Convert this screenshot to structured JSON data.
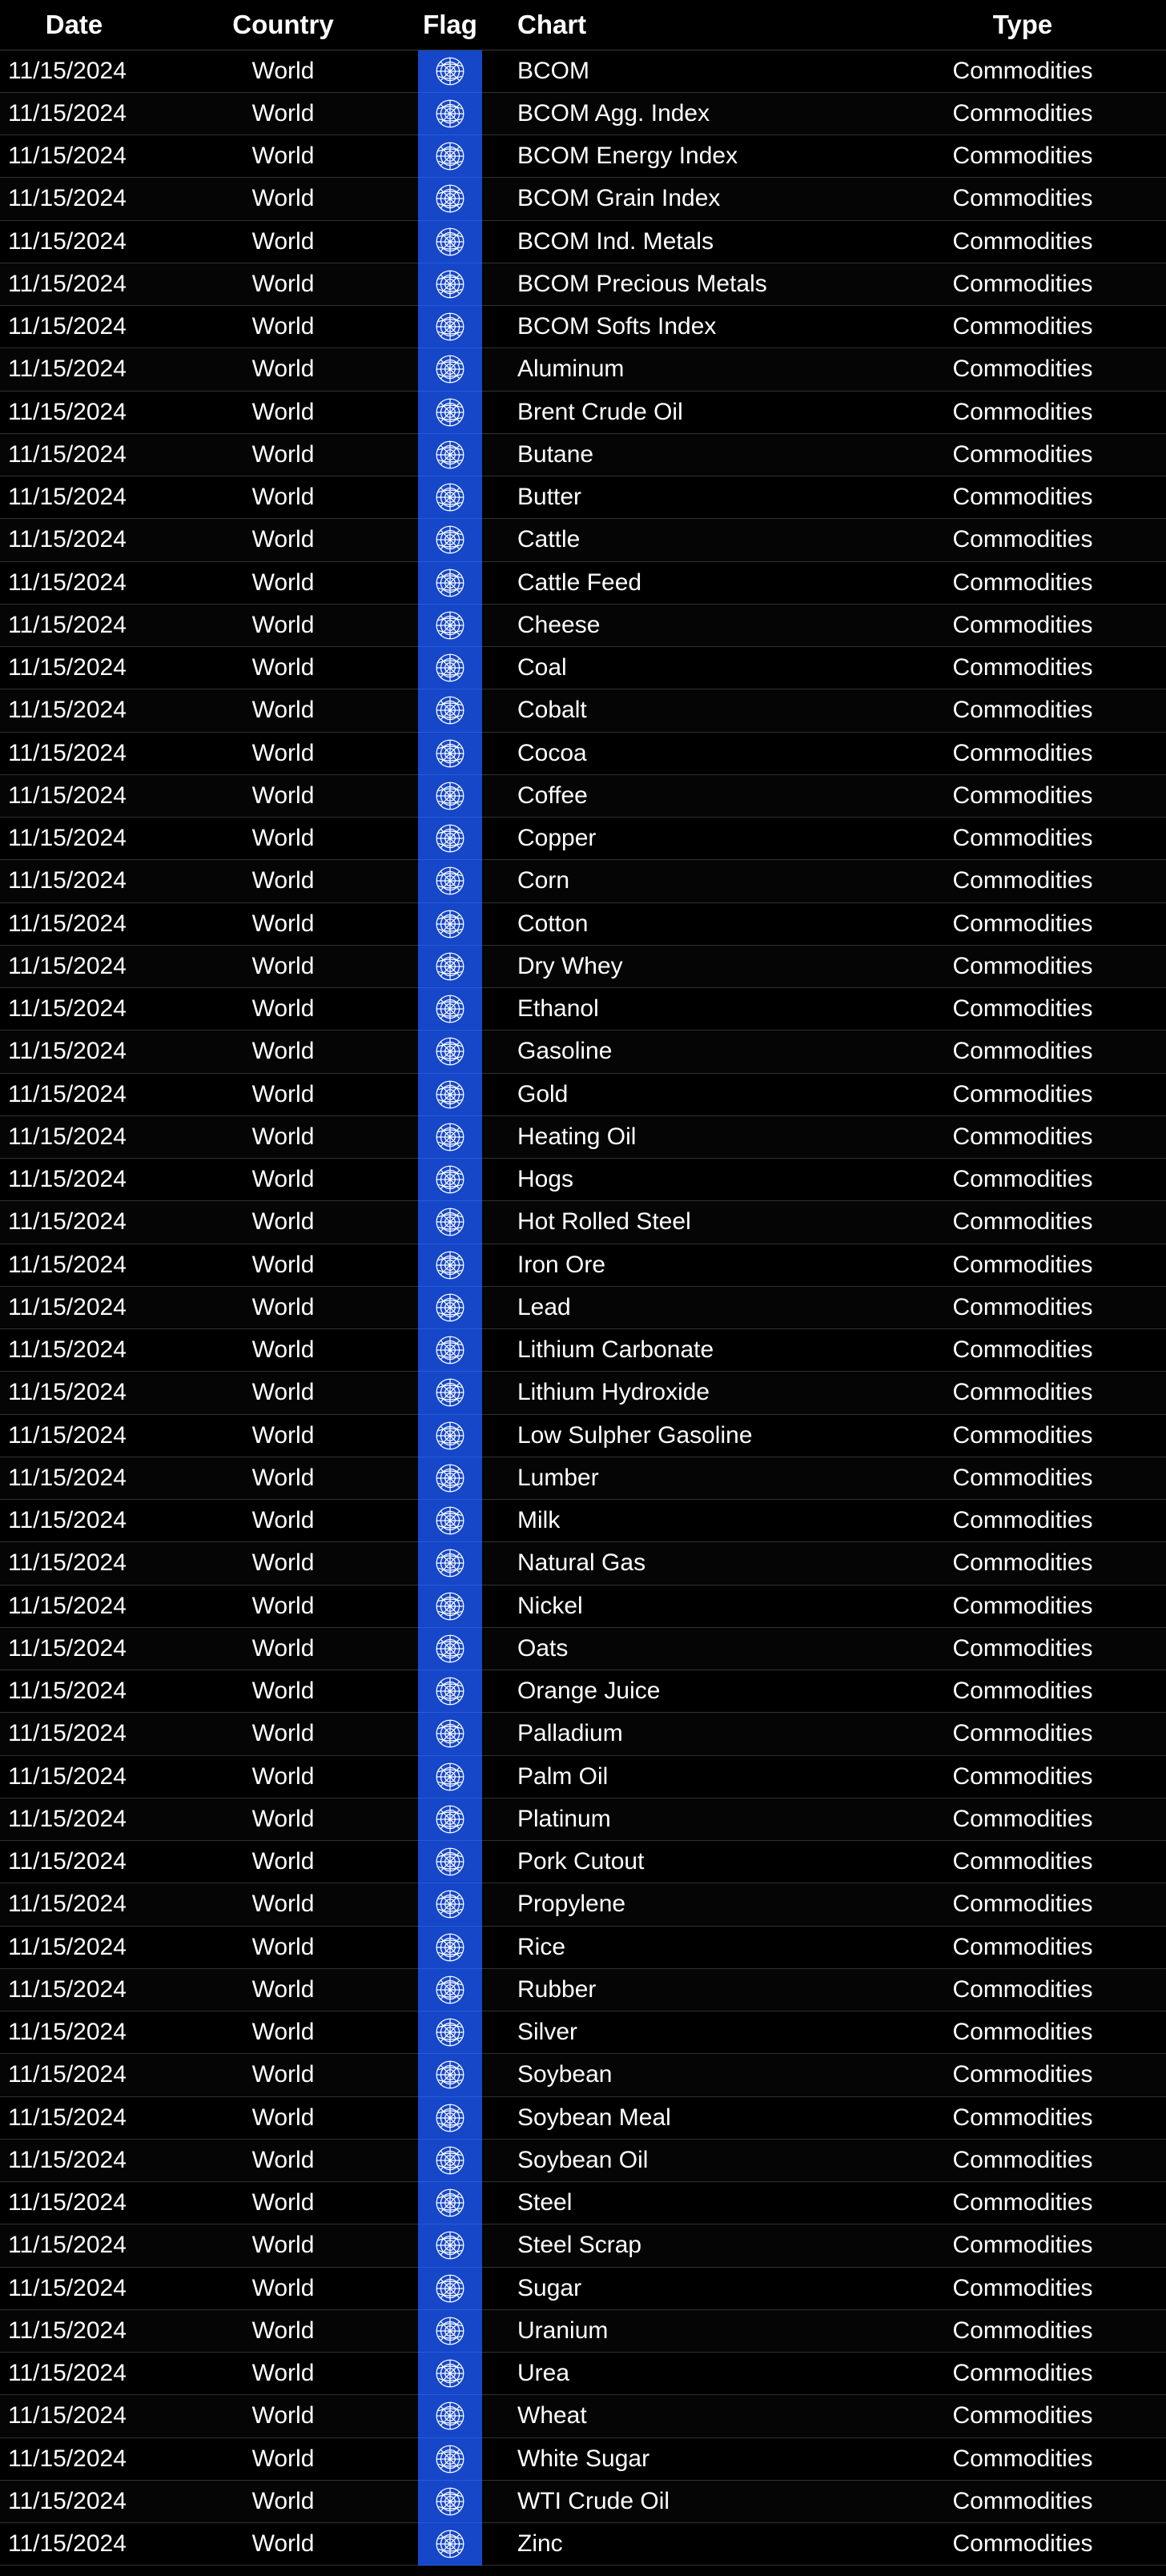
{
  "headers": {
    "date": "Date",
    "country": "Country",
    "flag": "Flag",
    "chart": "Chart",
    "type": "Type"
  },
  "colors": {
    "background": "#000000",
    "flag_cell": "#1547c8",
    "text": "#ffffff",
    "grid": "#303030"
  },
  "flag_icon": "un-world-emblem-icon",
  "rows": [
    {
      "date": "11/15/2024",
      "country": "World",
      "chart": "BCOM",
      "type": "Commodities"
    },
    {
      "date": "11/15/2024",
      "country": "World",
      "chart": "BCOM Agg. Index",
      "type": "Commodities"
    },
    {
      "date": "11/15/2024",
      "country": "World",
      "chart": "BCOM Energy Index",
      "type": "Commodities"
    },
    {
      "date": "11/15/2024",
      "country": "World",
      "chart": "BCOM Grain Index",
      "type": "Commodities"
    },
    {
      "date": "11/15/2024",
      "country": "World",
      "chart": "BCOM Ind. Metals",
      "type": "Commodities"
    },
    {
      "date": "11/15/2024",
      "country": "World",
      "chart": "BCOM Precious Metals",
      "type": "Commodities"
    },
    {
      "date": "11/15/2024",
      "country": "World",
      "chart": "BCOM Softs Index",
      "type": "Commodities"
    },
    {
      "date": "11/15/2024",
      "country": "World",
      "chart": "Aluminum",
      "type": "Commodities"
    },
    {
      "date": "11/15/2024",
      "country": "World",
      "chart": "Brent Crude Oil",
      "type": "Commodities"
    },
    {
      "date": "11/15/2024",
      "country": "World",
      "chart": "Butane",
      "type": "Commodities"
    },
    {
      "date": "11/15/2024",
      "country": "World",
      "chart": "Butter",
      "type": "Commodities"
    },
    {
      "date": "11/15/2024",
      "country": "World",
      "chart": "Cattle",
      "type": "Commodities"
    },
    {
      "date": "11/15/2024",
      "country": "World",
      "chart": "Cattle Feed",
      "type": "Commodities"
    },
    {
      "date": "11/15/2024",
      "country": "World",
      "chart": "Cheese",
      "type": "Commodities"
    },
    {
      "date": "11/15/2024",
      "country": "World",
      "chart": "Coal",
      "type": "Commodities"
    },
    {
      "date": "11/15/2024",
      "country": "World",
      "chart": "Cobalt",
      "type": "Commodities"
    },
    {
      "date": "11/15/2024",
      "country": "World",
      "chart": "Cocoa",
      "type": "Commodities"
    },
    {
      "date": "11/15/2024",
      "country": "World",
      "chart": "Coffee",
      "type": "Commodities"
    },
    {
      "date": "11/15/2024",
      "country": "World",
      "chart": "Copper",
      "type": "Commodities"
    },
    {
      "date": "11/15/2024",
      "country": "World",
      "chart": "Corn",
      "type": "Commodities"
    },
    {
      "date": "11/15/2024",
      "country": "World",
      "chart": "Cotton",
      "type": "Commodities"
    },
    {
      "date": "11/15/2024",
      "country": "World",
      "chart": "Dry Whey",
      "type": "Commodities"
    },
    {
      "date": "11/15/2024",
      "country": "World",
      "chart": "Ethanol",
      "type": "Commodities"
    },
    {
      "date": "11/15/2024",
      "country": "World",
      "chart": "Gasoline",
      "type": "Commodities"
    },
    {
      "date": "11/15/2024",
      "country": "World",
      "chart": "Gold",
      "type": "Commodities"
    },
    {
      "date": "11/15/2024",
      "country": "World",
      "chart": "Heating Oil",
      "type": "Commodities"
    },
    {
      "date": "11/15/2024",
      "country": "World",
      "chart": "Hogs",
      "type": "Commodities"
    },
    {
      "date": "11/15/2024",
      "country": "World",
      "chart": "Hot Rolled Steel",
      "type": "Commodities"
    },
    {
      "date": "11/15/2024",
      "country": "World",
      "chart": "Iron Ore",
      "type": "Commodities"
    },
    {
      "date": "11/15/2024",
      "country": "World",
      "chart": "Lead",
      "type": "Commodities"
    },
    {
      "date": "11/15/2024",
      "country": "World",
      "chart": "Lithium Carbonate",
      "type": "Commodities"
    },
    {
      "date": "11/15/2024",
      "country": "World",
      "chart": "Lithium Hydroxide",
      "type": "Commodities"
    },
    {
      "date": "11/15/2024",
      "country": "World",
      "chart": "Low Sulpher Gasoline",
      "type": "Commodities"
    },
    {
      "date": "11/15/2024",
      "country": "World",
      "chart": "Lumber",
      "type": "Commodities"
    },
    {
      "date": "11/15/2024",
      "country": "World",
      "chart": "Milk",
      "type": "Commodities"
    },
    {
      "date": "11/15/2024",
      "country": "World",
      "chart": "Natural Gas",
      "type": "Commodities"
    },
    {
      "date": "11/15/2024",
      "country": "World",
      "chart": "Nickel",
      "type": "Commodities"
    },
    {
      "date": "11/15/2024",
      "country": "World",
      "chart": "Oats",
      "type": "Commodities"
    },
    {
      "date": "11/15/2024",
      "country": "World",
      "chart": "Orange Juice",
      "type": "Commodities"
    },
    {
      "date": "11/15/2024",
      "country": "World",
      "chart": "Palladium",
      "type": "Commodities"
    },
    {
      "date": "11/15/2024",
      "country": "World",
      "chart": "Palm Oil",
      "type": "Commodities"
    },
    {
      "date": "11/15/2024",
      "country": "World",
      "chart": "Platinum",
      "type": "Commodities"
    },
    {
      "date": "11/15/2024",
      "country": "World",
      "chart": "Pork Cutout",
      "type": "Commodities"
    },
    {
      "date": "11/15/2024",
      "country": "World",
      "chart": "Propylene",
      "type": "Commodities"
    },
    {
      "date": "11/15/2024",
      "country": "World",
      "chart": "Rice",
      "type": "Commodities"
    },
    {
      "date": "11/15/2024",
      "country": "World",
      "chart": "Rubber",
      "type": "Commodities"
    },
    {
      "date": "11/15/2024",
      "country": "World",
      "chart": "Silver",
      "type": "Commodities"
    },
    {
      "date": "11/15/2024",
      "country": "World",
      "chart": "Soybean",
      "type": "Commodities"
    },
    {
      "date": "11/15/2024",
      "country": "World",
      "chart": "Soybean Meal",
      "type": "Commodities"
    },
    {
      "date": "11/15/2024",
      "country": "World",
      "chart": "Soybean Oil",
      "type": "Commodities"
    },
    {
      "date": "11/15/2024",
      "country": "World",
      "chart": "Steel",
      "type": "Commodities"
    },
    {
      "date": "11/15/2024",
      "country": "World",
      "chart": "Steel Scrap",
      "type": "Commodities"
    },
    {
      "date": "11/15/2024",
      "country": "World",
      "chart": "Sugar",
      "type": "Commodities"
    },
    {
      "date": "11/15/2024",
      "country": "World",
      "chart": "Uranium",
      "type": "Commodities"
    },
    {
      "date": "11/15/2024",
      "country": "World",
      "chart": "Urea",
      "type": "Commodities"
    },
    {
      "date": "11/15/2024",
      "country": "World",
      "chart": "Wheat",
      "type": "Commodities"
    },
    {
      "date": "11/15/2024",
      "country": "World",
      "chart": "White Sugar",
      "type": "Commodities"
    },
    {
      "date": "11/15/2024",
      "country": "World",
      "chart": "WTI Crude Oil",
      "type": "Commodities"
    },
    {
      "date": "11/15/2024",
      "country": "World",
      "chart": "Zinc",
      "type": "Commodities"
    }
  ]
}
